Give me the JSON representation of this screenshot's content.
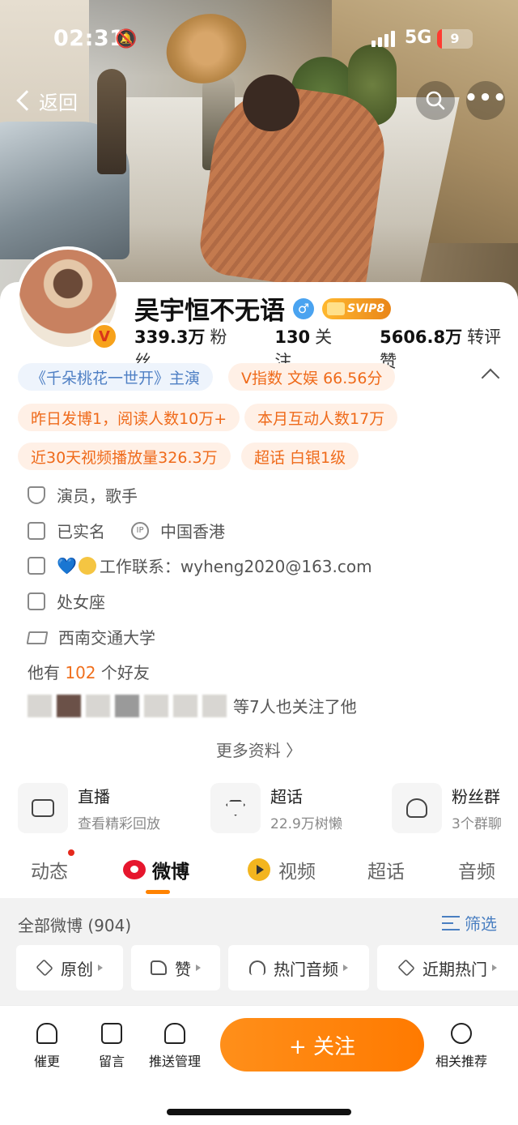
{
  "status_bar": {
    "time": "02:31",
    "network": "5G",
    "battery": "9"
  },
  "nav": {
    "back_label": "返回"
  },
  "profile": {
    "name": "吴宇恒不无语",
    "svip_label": "SVIP8",
    "avatar_badge": "V",
    "stats": [
      {
        "value": "339.3万",
        "label": "粉丝"
      },
      {
        "value": "130",
        "label": "关注"
      },
      {
        "value": "5606.8万",
        "label": "转评赞"
      }
    ]
  },
  "tags": {
    "role": "《千朵桃花一世开》主演",
    "v_index": "V指数 文娱 66.56分",
    "yesterday": "昨日发博1，阅读人数10万+",
    "interaction": "本月互动人数17万",
    "video_plays": "近30天视频播放量326.3万",
    "supertopic": "超话 白银1级"
  },
  "info": {
    "occupation": "演员，歌手",
    "verified": "已实名",
    "ip_label": "IP",
    "ip_location": "中国香港",
    "contact": "工作联系：wyheng2020@163.com",
    "zodiac": "处女座",
    "school": "西南交通大学",
    "friends_prefix": "他有",
    "friends_count": "102",
    "friends_suffix": "个好友",
    "mutual_follow": "等7人也关注了他",
    "more_info": "更多资料"
  },
  "shortcuts": [
    {
      "title": "直播",
      "subtitle": "查看精彩回放"
    },
    {
      "title": "超话",
      "subtitle": "22.9万树懒"
    },
    {
      "title": "粉丝群",
      "subtitle": "3个群聊"
    }
  ],
  "tabs": [
    "动态",
    "微博",
    "视频",
    "超话",
    "音频"
  ],
  "feed": {
    "all_label": "全部微博 (904)",
    "filter_label": "筛选",
    "chips": [
      "原创",
      "赞",
      "热门音频",
      "近期热门"
    ]
  },
  "bottom_bar": {
    "items": [
      "催更",
      "留言",
      "推送管理",
      "相关推荐"
    ],
    "follow_label": "+ 关注"
  },
  "colors": {
    "accent": "#ff8200",
    "link": "#4a7fc1",
    "tag_orange": "#ef6a1a",
    "tag_blue": "#4e7fc4"
  }
}
